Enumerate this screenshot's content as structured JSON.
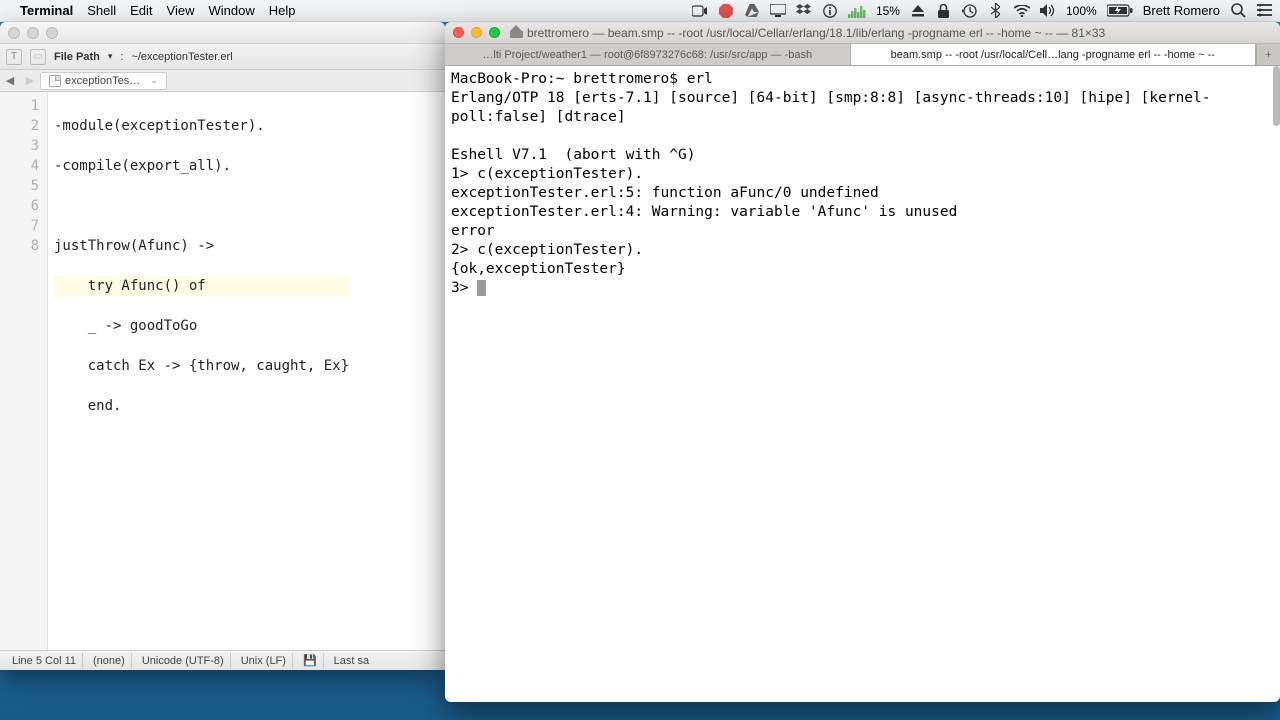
{
  "menubar": {
    "app": "Terminal",
    "items": [
      "Shell",
      "Edit",
      "View",
      "Window",
      "Help"
    ],
    "cpu_pct": "15%",
    "batt_pct": "100%",
    "username": "Brett Romero"
  },
  "editor": {
    "filepath_label": "File Path",
    "filepath_sep": ":",
    "filepath_value": "~/exceptionTester.erl",
    "tab_label": "exceptionTes…",
    "lines": [
      "-module(exceptionTester).",
      "-compile(export_all).",
      "",
      "justThrow(Afunc) ->",
      "    try Afunc() of",
      "    _ -> goodToGo",
      "    catch Ex -> {throw, caught, Ex}",
      "    end."
    ],
    "gutter": [
      "1",
      "2",
      "3",
      "4",
      "5",
      "6",
      "7",
      "8"
    ],
    "highlight_line_index": 4,
    "status": {
      "pos": "Line 5 Col 11",
      "lang": "(none)",
      "enc": "Unicode (UTF-8)",
      "lineend": "Unix (LF)",
      "save": "Last sa"
    }
  },
  "terminal": {
    "title": "brettromero — beam.smp -- -root /usr/local/Cellar/erlang/18.1/lib/erlang -progname erl -- -home ~ -- — 81×33",
    "tabs": [
      "…lti Project/weather1 — root@6f8973276c68: /usr/src/app — -bash",
      "beam.smp -- -root /usr/local/Cell…lang -progname erl -- -home ~ --"
    ],
    "active_tab": 1,
    "lines": [
      "MacBook-Pro:~ brettromero$ erl",
      "Erlang/OTP 18 [erts-7.1] [source] [64-bit] [smp:8:8] [async-threads:10] [hipe] [kernel-poll:false] [dtrace]",
      "",
      "Eshell V7.1  (abort with ^G)",
      "1> c(exceptionTester).",
      "exceptionTester.erl:5: function aFunc/0 undefined",
      "exceptionTester.erl:4: Warning: variable 'Afunc' is unused",
      "error",
      "2> c(exceptionTester).",
      "{ok,exceptionTester}",
      "3> "
    ]
  }
}
